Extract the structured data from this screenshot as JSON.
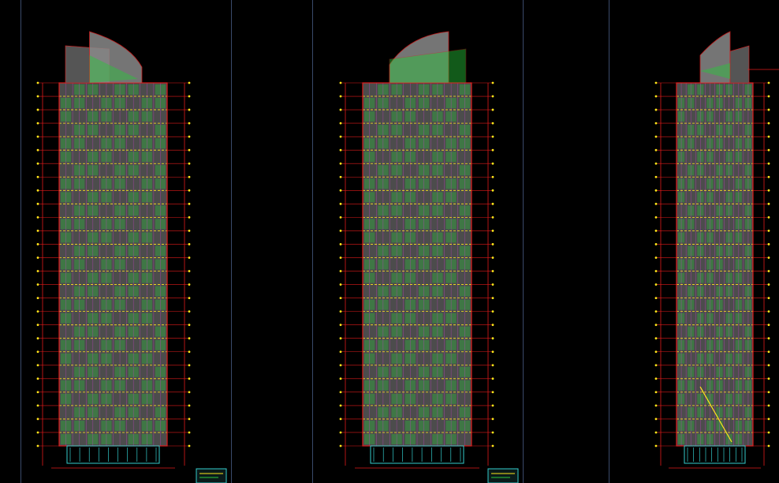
{
  "drawing": {
    "background": "#000000",
    "colors": {
      "facade": "#8a8a8a",
      "glass_green": "#29c83a",
      "grid_red": "#e01b1b",
      "dim_yellow": "#ffe81a",
      "line_magenta": "#c040c0",
      "base_cyan": "#33cccc",
      "sheet_line": "#3a4a6a"
    },
    "elevations": [
      {
        "id": "elevation-left",
        "floors": 27,
        "crown": "left-sail"
      },
      {
        "id": "elevation-middle",
        "floors": 27,
        "crown": "right-sail"
      },
      {
        "id": "elevation-right",
        "floors": 27,
        "crown": "split-sail"
      }
    ]
  }
}
